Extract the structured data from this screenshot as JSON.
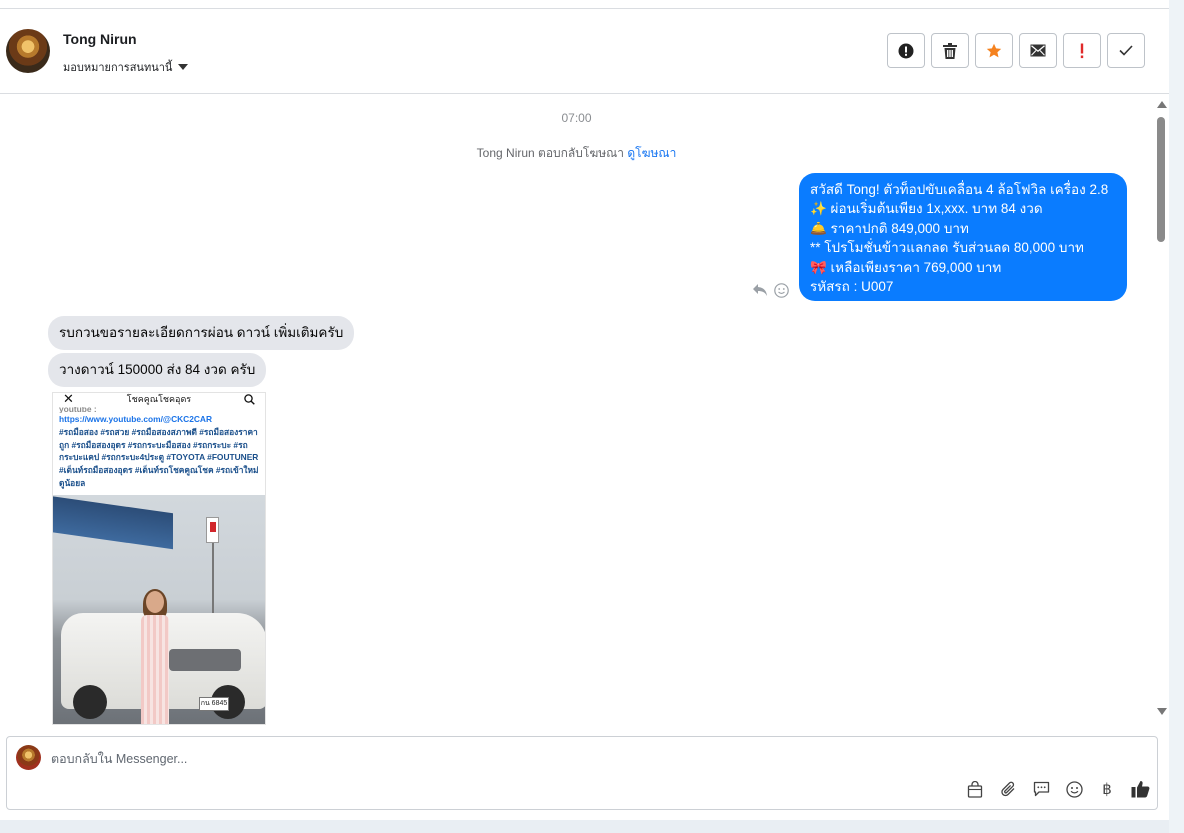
{
  "header": {
    "contact_name": "Tong Nirun",
    "assign_label": "มอบหมายการสนทนานี้",
    "actions": [
      {
        "name": "spam-button",
        "icon": "alert-circle-icon"
      },
      {
        "name": "delete-button",
        "icon": "trash-icon"
      },
      {
        "name": "star-button",
        "icon": "star-icon"
      },
      {
        "name": "mark-unread-button",
        "icon": "envelope-icon"
      },
      {
        "name": "important-button",
        "icon": "exclamation-icon"
      },
      {
        "name": "done-button",
        "icon": "check-icon"
      }
    ]
  },
  "chat": {
    "time": "07:00",
    "system_prefix": "Tong Nirun ตอบกลับโฆษณา",
    "system_link": "ดูโฆษณา",
    "outgoing": {
      "lines": [
        "สวัสดี Tong! ตัวท็อปขับเคลื่อน 4 ล้อโฟวิล เครื่อง 2.8",
        "✨  ผ่อนเริ่มต้นเพียง 1x,xxx. บาท 84 งวด",
        "🛎️ ราคาปกติ 849,000 บาท",
        "** โปรโมชั่นข้าวแลกลด รับส่วนลด 80,000 บาท",
        "🎀  เหลือเพียงราคา 769,000 บาท",
        " รหัสรถ : U007"
      ]
    },
    "incoming": [
      "รบกวนขอรายละเอียดการผ่อน  ดาวน์ เพิ่มเติมครับ",
      "วางดาวน์  150000  ส่ง 84 งวด ครับ"
    ],
    "shared_post": {
      "top_title": "โชคคูณโชคอุดร",
      "source": "youtube :",
      "url": "https://www.youtube.com/@CKC2CAR",
      "hashtags": "#รถมือสอง #รถสวย #รถมือสองสภาพดี #รถมือสองราคาถูก #รถมือสองอุดร #รถกระบะมือสอง #รถกระบะ #รถกระบะแคป #รถกระบะ4ประตู #TOYOTA #FOUTUNER #เต็นท์รถมือสองอุดร #เต็นท์รถโชคคูณโชค #รถเข้าใหม่ ดูน้อยล",
      "plate": "กน 6845"
    }
  },
  "composer": {
    "placeholder": "ตอบกลับใน Messenger...",
    "tools": [
      "shopping-bag-icon",
      "paperclip-icon",
      "saved-reply-icon",
      "emoji-icon",
      "baht-icon",
      "thumbs-up-icon"
    ]
  },
  "colors": {
    "outgoing_bubble": "#0a7cff",
    "incoming_bubble": "#e4e6eb",
    "star": "#f5821f",
    "important": "#e02a2a"
  }
}
